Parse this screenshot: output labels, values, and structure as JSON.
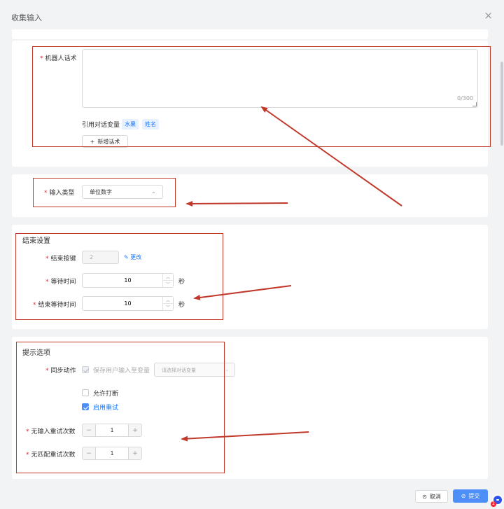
{
  "dialog": {
    "title": "收集输入",
    "close_icon": "×"
  },
  "robot_speech": {
    "label": "机器人话术",
    "required_mark": "*",
    "placeholder": "",
    "counter": "0/300",
    "vars_label": "引用对话变量",
    "vars": [
      "水果",
      "姓名"
    ],
    "add_button": "新增话术",
    "add_icon": "+"
  },
  "input_type": {
    "label": "输入类型",
    "required_mark": "*",
    "value": "单位数字"
  },
  "end_settings": {
    "title": "结束设置",
    "end_key": {
      "label": "结束按键",
      "required_mark": "*",
      "value": "2",
      "edit_label": "更改"
    },
    "wait_time": {
      "label": "等待时间",
      "required_mark": "*",
      "value": "10",
      "unit": "秒"
    },
    "end_wait_time": {
      "label": "结束等待时间",
      "required_mark": "*",
      "value": "10",
      "unit": "秒"
    }
  },
  "prompt_options": {
    "title": "提示选项",
    "sync_action": {
      "label": "同步动作",
      "required_mark": "*",
      "save_label": "保存用户输入至变量",
      "select_placeholder": "请选择对话变量"
    },
    "allow_interrupt": {
      "label": "允许打断",
      "checked": false
    },
    "enable_retry": {
      "label": "启用重试",
      "checked": true
    },
    "no_input_retries": {
      "label": "无输入重试次数",
      "required_mark": "*",
      "value": "1"
    },
    "no_match_retries": {
      "label": "无匹配重试次数",
      "required_mark": "*",
      "value": "1"
    }
  },
  "footer": {
    "cancel_label": "取消",
    "submit_label": "提交",
    "badge": "2"
  },
  "colors": {
    "accent": "#4e8ef7",
    "annotation": "#c0392b",
    "required": "#f5222d"
  }
}
